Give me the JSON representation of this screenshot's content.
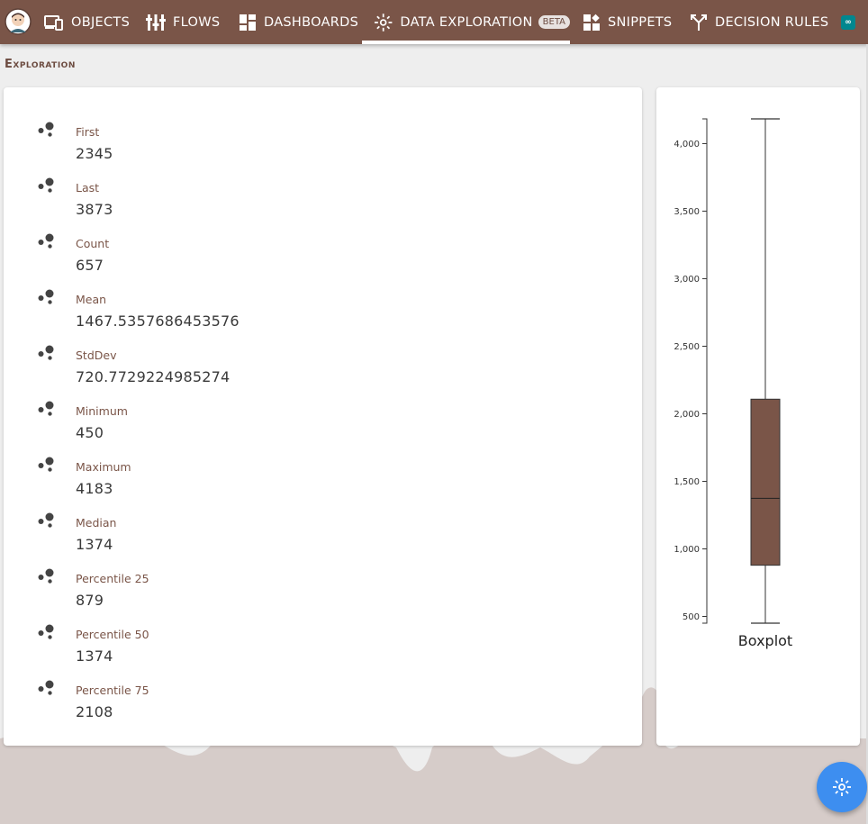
{
  "nav": {
    "items": [
      {
        "label": "OBJECTS",
        "icon": "devices-icon"
      },
      {
        "label": "FLOWS",
        "icon": "flows-icon"
      },
      {
        "label": "DASHBOARDS",
        "icon": "dashboard-icon"
      },
      {
        "label": "DATA EXPLORATION",
        "icon": "explore-icon",
        "badge": "BETA",
        "active": true
      },
      {
        "label": "SNIPPETS",
        "icon": "snippets-icon"
      },
      {
        "label": "DECISION RULES",
        "icon": "fork-icon"
      }
    ]
  },
  "section_title": "Exploration",
  "stats": [
    {
      "label": "First",
      "value": "2345"
    },
    {
      "label": "Last",
      "value": "3873"
    },
    {
      "label": "Count",
      "value": "657"
    },
    {
      "label": "Mean",
      "value": "1467.5357686453576"
    },
    {
      "label": "StdDev",
      "value": "720.7729224985274"
    },
    {
      "label": "Minimum",
      "value": "450"
    },
    {
      "label": "Maximum",
      "value": "4183"
    },
    {
      "label": "Median",
      "value": "1374"
    },
    {
      "label": "Percentile 25",
      "value": "879"
    },
    {
      "label": "Percentile 50",
      "value": "1374"
    },
    {
      "label": "Percentile 75",
      "value": "2108"
    }
  ],
  "chart_data": {
    "type": "boxplot",
    "xlabel": "Boxplot",
    "min": 450,
    "q1": 879,
    "median": 1374,
    "q3": 2108,
    "max": 4183,
    "ylim": [
      450,
      4183
    ],
    "yticks": [
      500,
      1000,
      1500,
      2000,
      2500,
      3000,
      3500,
      4000
    ],
    "ytick_labels": [
      "500",
      "1,000",
      "1,500",
      "2,000",
      "2,500",
      "3,000",
      "3,500",
      "4,000"
    ],
    "box_color": "#7a5548"
  },
  "colors": {
    "brand": "#7a5548",
    "fab": "#3d8ef0",
    "badge_teal": "#00878f"
  }
}
